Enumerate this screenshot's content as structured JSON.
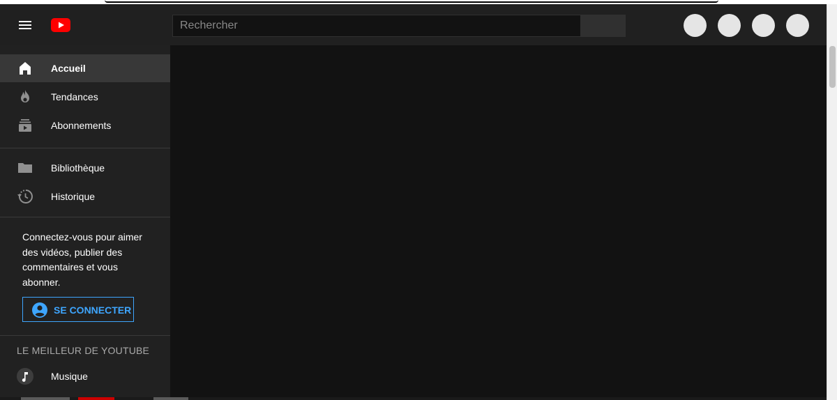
{
  "masthead": {
    "search_placeholder": "Rechercher"
  },
  "sidebar": {
    "primary": [
      {
        "label": "Accueil",
        "icon": "home-icon",
        "active": true
      },
      {
        "label": "Tendances",
        "icon": "flame-icon",
        "active": false
      },
      {
        "label": "Abonnements",
        "icon": "subscriptions-icon",
        "active": false
      }
    ],
    "secondary": [
      {
        "label": "Bibliothèque",
        "icon": "folder-icon"
      },
      {
        "label": "Historique",
        "icon": "history-icon"
      }
    ],
    "signin_prompt": "Connectez-vous pour aimer des vidéos, publier des commentaires et vous abonner.",
    "signin_button": "SE CONNECTER",
    "best_of_title": "LE MEILLEUR DE YOUTUBE",
    "best_of": [
      {
        "label": "Musique",
        "icon": "music-note-icon"
      }
    ]
  },
  "colors": {
    "brand_red": "#ff0000",
    "accent_blue": "#3ea6ff",
    "masthead_bg": "#202020",
    "sidebar_bg": "#212121",
    "content_bg": "#121212",
    "active_item_bg": "#383838"
  }
}
